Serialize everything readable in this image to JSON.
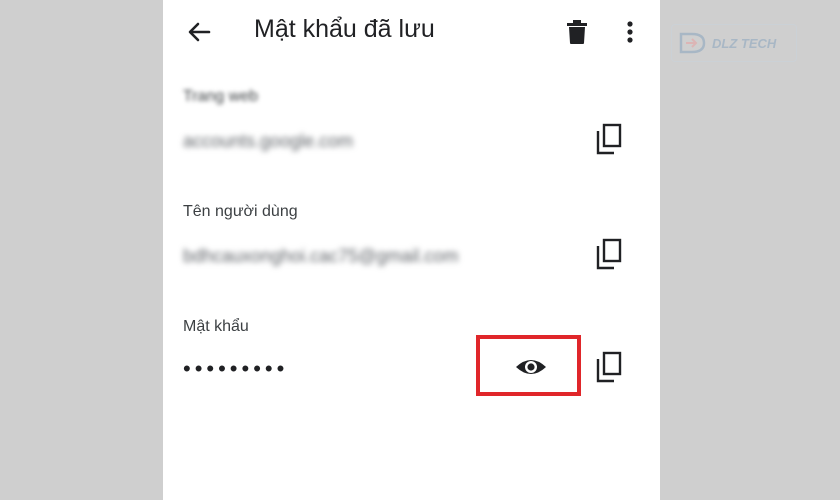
{
  "header": {
    "title": "Mật khẩu đã lưu",
    "back_icon": "arrow-back-icon",
    "delete_icon": "trash-icon",
    "more_icon": "more-vert-icon"
  },
  "fields": [
    {
      "label": "Trang web",
      "value": "accounts.google.com",
      "copy_icon": "copy-icon"
    },
    {
      "label": "Tên người dùng",
      "value": "bdhcauxonghoi.cac75@gmail.com",
      "copy_icon": "copy-icon"
    },
    {
      "label": "Mật khẩu",
      "value": "•••••••••",
      "show_icon": "eye-icon",
      "copy_icon": "copy-icon"
    }
  ],
  "watermark": {
    "text": "DLZ TECH"
  },
  "colors": {
    "highlight": "#e0262a",
    "text": "#202124"
  }
}
